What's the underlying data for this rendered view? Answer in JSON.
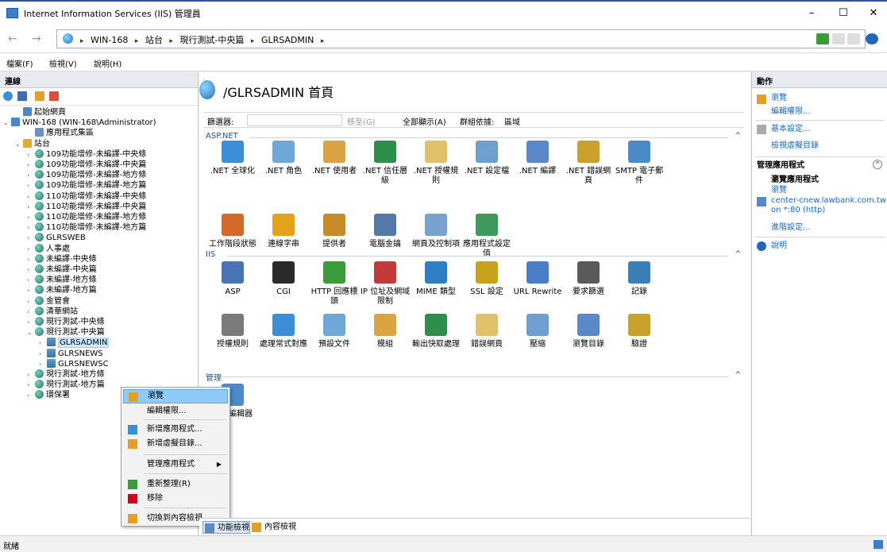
{
  "window": {
    "title": "Internet Information Services (IIS) 管理員",
    "minimize": "–",
    "maximize": "☐",
    "close": "✕"
  },
  "address": {
    "back": "←",
    "forward": "→",
    "crumbs": [
      "WIN-168",
      "站台",
      "現行測試-中央篇",
      "GLRSADMIN"
    ],
    "sep": "▸"
  },
  "menu": [
    "檔案(F)",
    "檢視(V)",
    "說明(H)"
  ],
  "connections": {
    "title": "連線",
    "tree": [
      {
        "label": "起始網頁",
        "indent": 1,
        "icon": "page"
      },
      {
        "label": "WIN-168 (WIN-168\\Administrator)",
        "indent": 0,
        "icon": "page",
        "arrow": "v"
      },
      {
        "label": "應用程式集區",
        "indent": 2,
        "icon": "pool"
      },
      {
        "label": "站台",
        "indent": 1,
        "icon": "folder",
        "arrow": "v"
      },
      {
        "label": "109功能增修-未編譯-中央條",
        "indent": 2,
        "icon": "site",
        "arrow": ">"
      },
      {
        "label": "109功能增修-未編譯-中央篇",
        "indent": 2,
        "icon": "site",
        "arrow": ">"
      },
      {
        "label": "109功能增修-未編譯-地方條",
        "indent": 2,
        "icon": "site",
        "arrow": ">"
      },
      {
        "label": "109功能增修-未編譯-地方篇",
        "indent": 2,
        "icon": "site",
        "arrow": ">"
      },
      {
        "label": "110功能增修-未編譯-中央條",
        "indent": 2,
        "icon": "site",
        "arrow": ">"
      },
      {
        "label": "110功能增修-未編譯-中央篇",
        "indent": 2,
        "icon": "site",
        "arrow": ">"
      },
      {
        "label": "110功能增修-未編譯-地方條",
        "indent": 2,
        "icon": "site",
        "arrow": ">"
      },
      {
        "label": "110功能增修-未編譯-地方篇",
        "indent": 2,
        "icon": "site",
        "arrow": ">"
      },
      {
        "label": "GLRSWEB",
        "indent": 2,
        "icon": "site",
        "arrow": ">"
      },
      {
        "label": "人事處",
        "indent": 2,
        "icon": "site",
        "arrow": ">"
      },
      {
        "label": "未編譯-中央條",
        "indent": 2,
        "icon": "site",
        "arrow": ">"
      },
      {
        "label": "未編譯-中央篇",
        "indent": 2,
        "icon": "site",
        "arrow": ">"
      },
      {
        "label": "未編譯-地方條",
        "indent": 2,
        "icon": "site",
        "arrow": ">"
      },
      {
        "label": "未編譯-地方篇",
        "indent": 2,
        "icon": "site",
        "arrow": ">"
      },
      {
        "label": "金管會",
        "indent": 2,
        "icon": "site",
        "arrow": ">"
      },
      {
        "label": "清華網站",
        "indent": 2,
        "icon": "site",
        "arrow": ">"
      },
      {
        "label": "現行測試-中央條",
        "indent": 2,
        "icon": "site",
        "arrow": ">"
      },
      {
        "label": "現行測試-中央篇",
        "indent": 2,
        "icon": "site",
        "arrow": "v"
      },
      {
        "label": "GLRSADMIN",
        "indent": 3,
        "icon": "app",
        "arrow": ">",
        "selected": true
      },
      {
        "label": "GLRSNEWS",
        "indent": 3,
        "icon": "app",
        "arrow": ">"
      },
      {
        "label": "GLRSNEWSC",
        "indent": 3,
        "icon": "app",
        "arrow": ">"
      },
      {
        "label": "現行測試-地方條",
        "indent": 2,
        "icon": "site",
        "arrow": ">"
      },
      {
        "label": "現行測試-地方篇",
        "indent": 2,
        "icon": "site",
        "arrow": ">"
      },
      {
        "label": "環保署",
        "indent": 2,
        "icon": "site",
        "arrow": ">"
      }
    ]
  },
  "center": {
    "title": "/GLRSADMIN 首頁",
    "filter_label": "篩選器:",
    "goto": "移至(G)",
    "show_all": "全部顯示(A)",
    "group_by": "群組依據:",
    "group_value": "區域",
    "sections": [
      {
        "name": "ASP.NET",
        "items": [
          ".NET 全球化",
          ".NET 角色",
          ".NET 使用者",
          ".NET 信任層級",
          ".NET 授權規則",
          ".NET 設定檔",
          ".NET 編譯",
          ".NET 錯誤網頁",
          "SMTP 電子郵件",
          "工作階段狀態",
          "連線字串",
          "提供者",
          "電腦金鑰",
          "網頁及控制項",
          "應用程式設定值"
        ]
      },
      {
        "name": "IIS",
        "items": [
          "ASP",
          "CGI",
          "HTTP 回應標頭",
          "IP 位址及網域限制",
          "MIME 類型",
          "SSL 設定",
          "URL Rewrite",
          "要求篩選",
          "記錄",
          "授權規則",
          "處理常式對應",
          "預設文件",
          "模組",
          "輸出快取處理",
          "錯誤網頁",
          "壓縮",
          "瀏覽目錄",
          "驗證"
        ]
      },
      {
        "name": "管理",
        "items": [
          "組態編輯器"
        ]
      }
    ],
    "icon_colors": [
      "#3a8fd6",
      "#6fa7d8",
      "#d9a441",
      "#2f8f4a",
      "#e0c068",
      "#6f9fcf",
      "#5a88c8",
      "#c7a12c",
      "#4c8bc8",
      "#d46a2a",
      "#e3a21a",
      "#c98a2a",
      "#5577a8",
      "#7aa2cf",
      "#3e9a5c",
      "#4a73b5",
      "#2b2b2b",
      "#3b9b3b",
      "#c43a3a",
      "#2f7fc7",
      "#c8a21a",
      "#4a7fc8",
      "#5a5a5a",
      "#3a7fb5",
      "#7a7a7a"
    ]
  },
  "context_menu": {
    "items": [
      "瀏覽",
      "編輯權限...",
      "新增應用程式...",
      "新增虛擬目錄...",
      "管理應用程式",
      "重新整理(R)",
      "移除",
      "切換到內容檢視"
    ],
    "submenu_arrow": "▶"
  },
  "bottom_tabs": [
    "功能檢視",
    "內容檢視"
  ],
  "actions": {
    "title": "動作",
    "browse": "瀏覽",
    "edit_perm": "編輯權限...",
    "basic_settings": "基本設定...",
    "view_vdirs": "檢視虛擬目錄",
    "manage_app_title": "管理應用程式",
    "browse_app_title": "瀏覽應用程式",
    "browse_app_sub": "瀏覽",
    "binding_1": "center-cnew.lawbank.com.tw",
    "binding_2": "on *:80 (http)",
    "advanced": "進階設定...",
    "help": "說明",
    "collapse": "^"
  },
  "status": {
    "text": "就緒"
  }
}
